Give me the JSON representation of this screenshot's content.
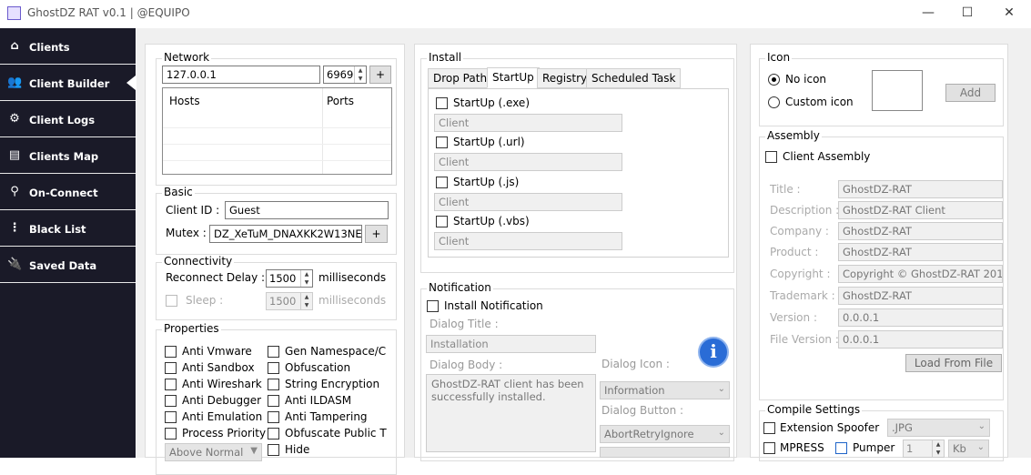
{
  "window": {
    "title": "GhostDZ RAT v0.1  | @EQUIPO",
    "minimize": "—",
    "maximize": "☐",
    "close": "✕"
  },
  "sidebar": {
    "items": [
      {
        "label": "Clients",
        "icon": "home-icon"
      },
      {
        "label": "Client Builder",
        "icon": "users-icon"
      },
      {
        "label": "Client Logs",
        "icon": "gear-icon"
      },
      {
        "label": "Clients Map",
        "icon": "map-icon"
      },
      {
        "label": "On-Connect",
        "icon": "location-icon"
      },
      {
        "label": "Black List",
        "icon": "blacklist-icon"
      },
      {
        "label": "Saved Data",
        "icon": "plug-icon"
      }
    ]
  },
  "network": {
    "title": "Network",
    "host": "127.0.0.1",
    "port": "6969",
    "add": "+",
    "col_hosts": "Hosts",
    "col_ports": "Ports"
  },
  "basic": {
    "title": "Basic",
    "client_id_label": "Client ID :",
    "client_id": "Guest",
    "mutex_label": "Mutex :",
    "mutex": "DZ_XeTuM_DNAXKK2W13NE",
    "add": "+"
  },
  "connectivity": {
    "title": "Connectivity",
    "reconnect_label": "Reconnect Delay :",
    "reconnect_value": "1500",
    "ms1": "milliseconds",
    "sleep_label": "Sleep :",
    "sleep_value": "1500",
    "ms2": "milliseconds"
  },
  "properties": {
    "title": "Properties",
    "left": [
      "Anti Vmware",
      "Anti Sandbox",
      "Anti Wireshark",
      "Anti Debugger",
      "Anti Emulation",
      "Process Priority"
    ],
    "right": [
      "Gen Namespace/C",
      "Obfuscation",
      "String Encryption",
      "Anti ILDASM",
      "Anti Tampering",
      "Obfuscate Public T",
      "Hide"
    ],
    "priority": "Above Normal"
  },
  "install": {
    "title": "Install",
    "tabs": [
      "Drop Path",
      "StartUp",
      "Registry",
      "Scheduled Task"
    ],
    "startup": [
      {
        "label": "StartUp (.exe)",
        "value": "Client"
      },
      {
        "label": "StartUp (.url)",
        "value": "Client"
      },
      {
        "label": "StartUp (.js)",
        "value": "Client"
      },
      {
        "label": "StartUp (.vbs)",
        "value": "Client"
      }
    ]
  },
  "notification": {
    "title": "Notification",
    "install_label": "Install Notification",
    "dialog_title_label": "Dialog Title :",
    "dialog_title": "Installation",
    "dialog_body_label": "Dialog Body :",
    "dialog_body": "GhostDZ-RAT client has been successfully installed.",
    "dialog_icon_label": "Dialog Icon :",
    "dialog_icon": "Information",
    "dialog_button_label": "Dialog Button :",
    "dialog_button": "AbortRetryIgnore",
    "info_glyph": "i"
  },
  "icon": {
    "title": "Icon",
    "no_icon": "No icon",
    "custom_icon": "Custom icon",
    "add": "Add"
  },
  "assembly": {
    "title": "Assembly",
    "client_assembly": "Client Assembly",
    "fields": [
      {
        "label": "Title :",
        "value": "GhostDZ-RAT"
      },
      {
        "label": "Description :",
        "value": "GhostDZ-RAT Client"
      },
      {
        "label": "Company :",
        "value": "GhostDZ-RAT"
      },
      {
        "label": "Product :",
        "value": "GhostDZ-RAT"
      },
      {
        "label": "Copyright :",
        "value": "Copyright © GhostDZ-RAT 201"
      },
      {
        "label": "Trademark :",
        "value": "GhostDZ-RAT"
      },
      {
        "label": "Version :",
        "value": "0.0.0.1"
      },
      {
        "label": "File Version :",
        "value": "0.0.0.1"
      }
    ],
    "load": "Load From File"
  },
  "compile": {
    "title": "Compile Settings",
    "spoofer": "Extension Spoofer",
    "spoofer_ext": ".JPG",
    "mpress": "MPRESS",
    "pumper": "Pumper",
    "pump_value": "1",
    "pump_unit": "Kb"
  },
  "colors": {
    "sidebar_bg": "#1a1a28",
    "accent_blue": "#1e64c8"
  }
}
